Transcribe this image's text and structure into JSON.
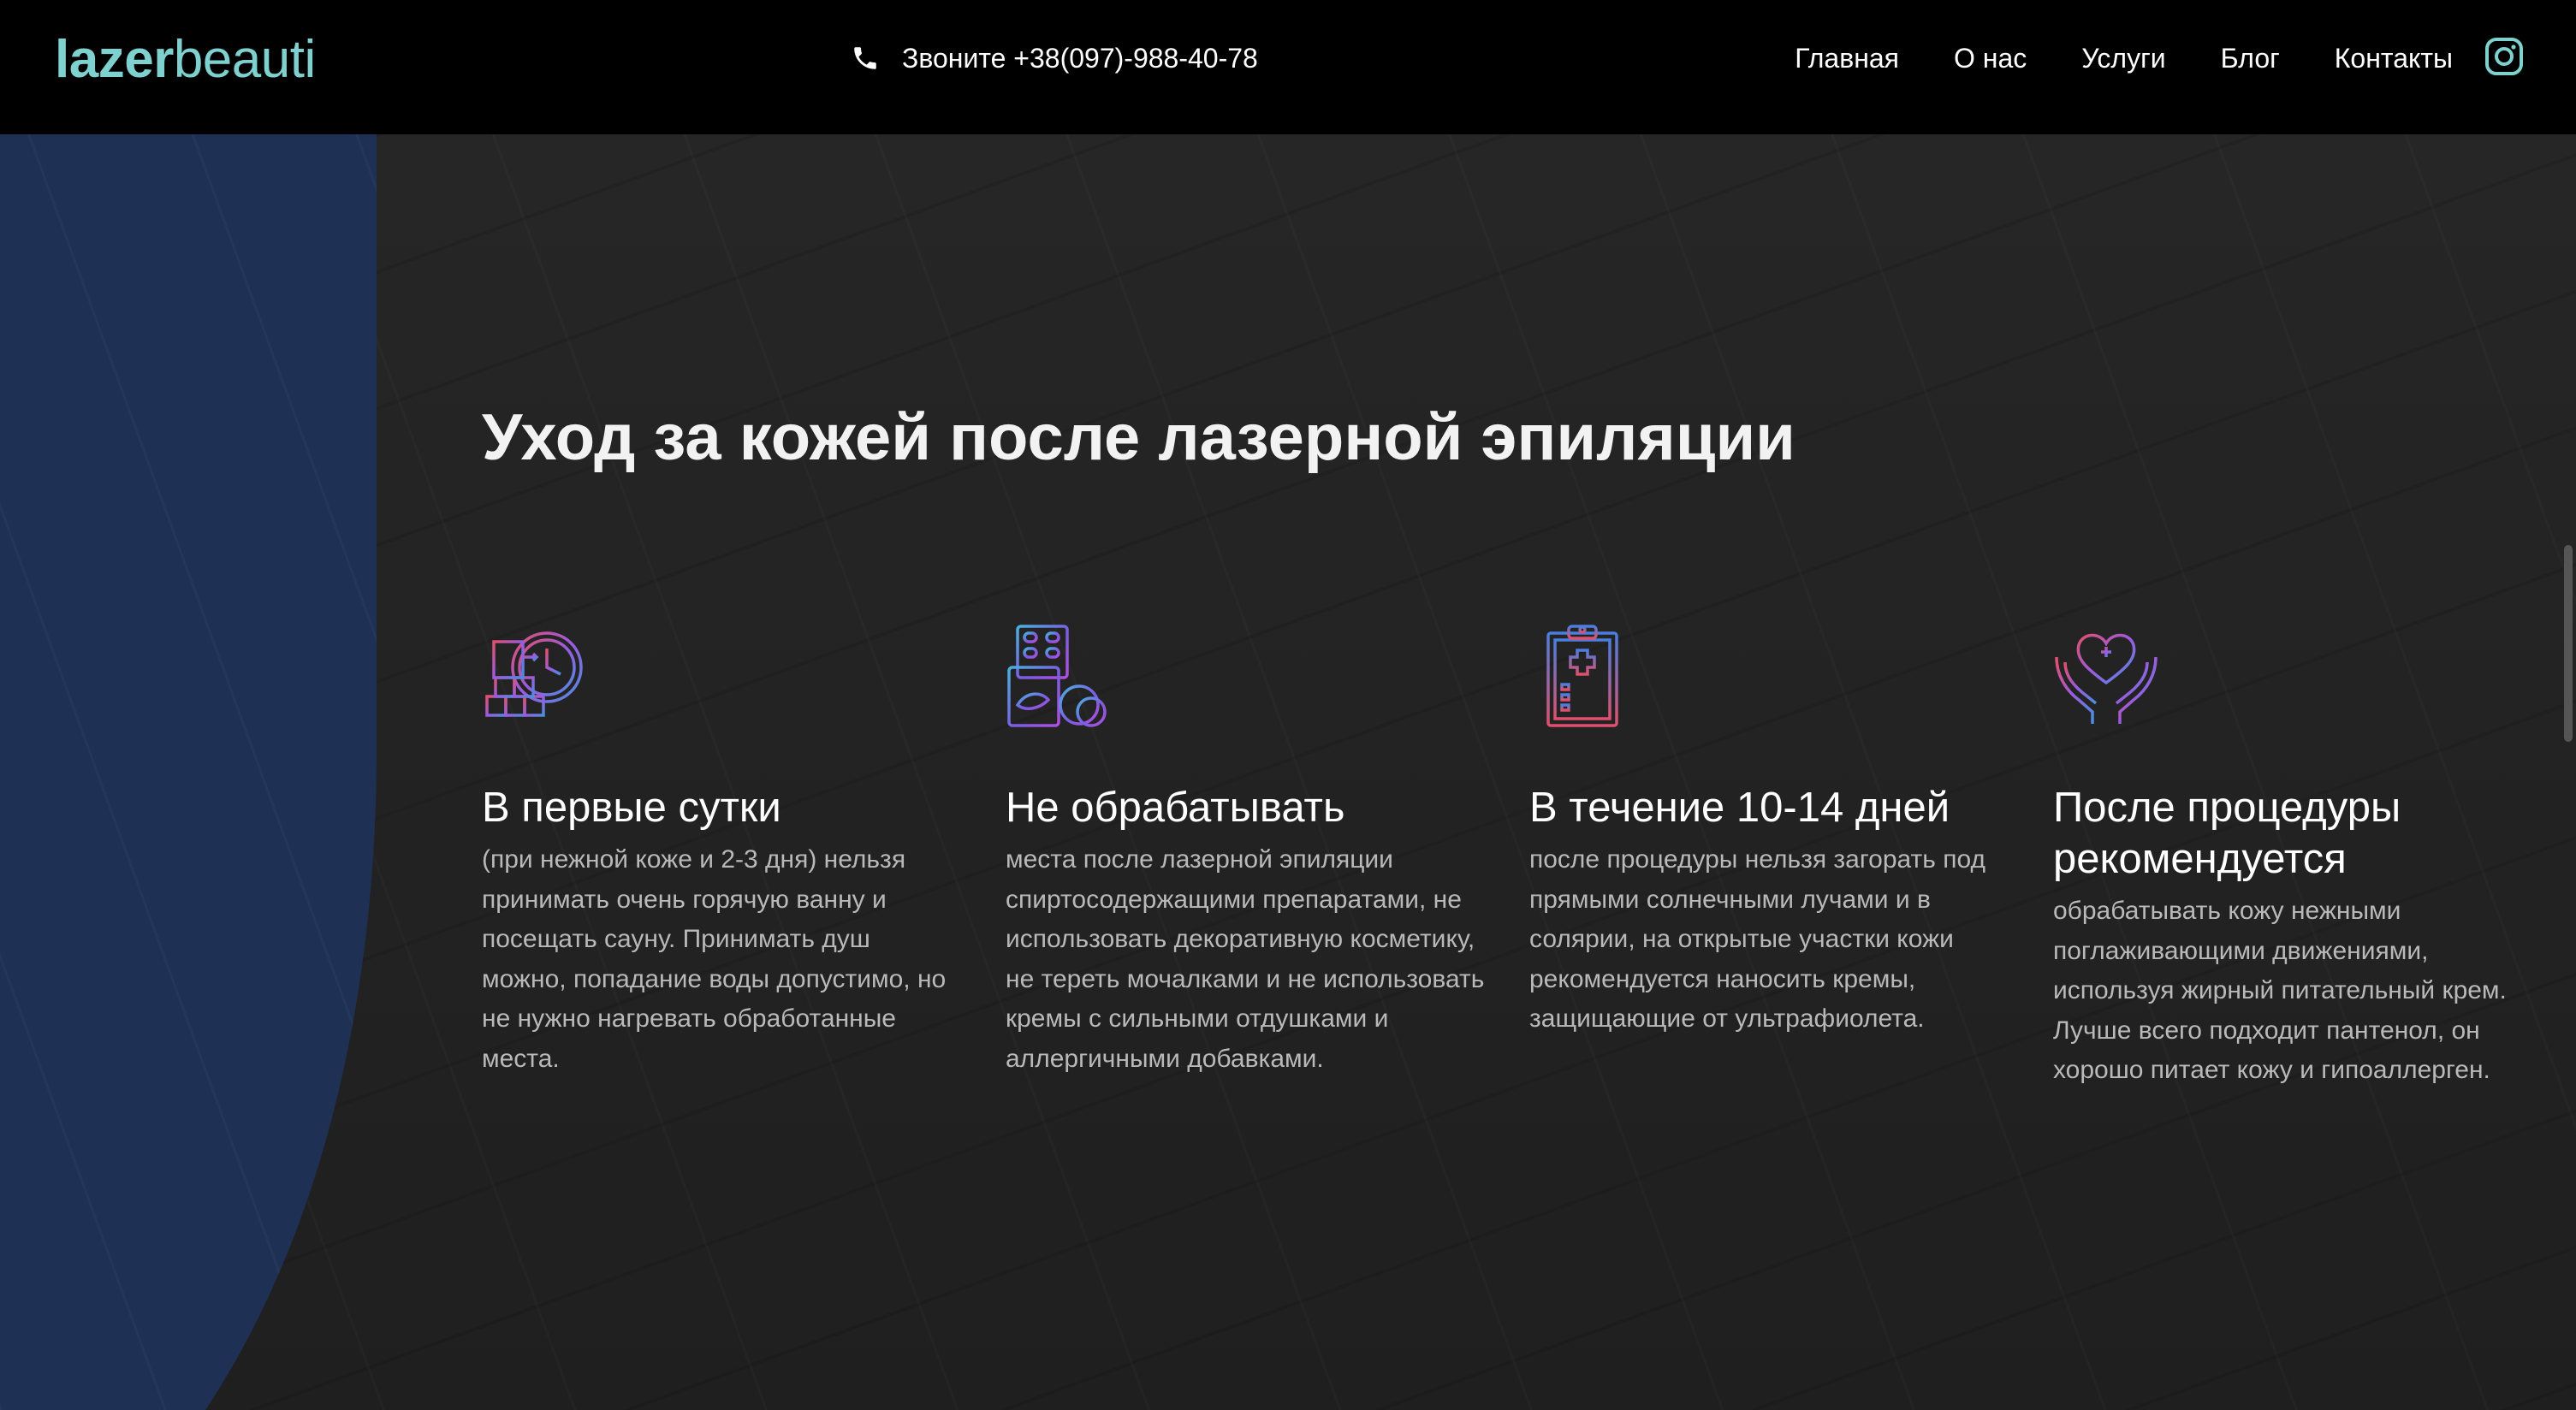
{
  "header": {
    "logo_bold": "lazer",
    "logo_light": "beauti",
    "phone_text": "Звоните +38(097)-988-40-78",
    "nav": [
      "Главная",
      "О нас",
      "Услуги",
      "Блог",
      "Контакты"
    ]
  },
  "section": {
    "title": "Уход за кожей после лазерной эпиляции",
    "cards": [
      {
        "icon": "time-blocks-icon",
        "title": "В первые сутки",
        "text": "(при нежной коже и 2-3 дня) нельзя принимать очень горячую ванну и посещать сауну. Принимать душ можно, попадание воды допустимо, но не нужно нагревать обработанные места."
      },
      {
        "icon": "pills-icon",
        "title": "Не обрабатывать",
        "text": "места после лазерной эпиляции спиртосодержащими препаратами, не использовать декоративную косметику, не тереть мочалками и не использовать кремы с сильными отдушками и аллергичными добавками."
      },
      {
        "icon": "medical-clipboard-icon",
        "title": "В течение 10-14 дней",
        "text": "после процедуры нельзя загорать под прямыми солнечными лучами и в солярии, на открытые участки кожи рекомендуется наносить кремы, защищающие от ультрафиолета."
      },
      {
        "icon": "heart-hands-icon",
        "title": "После процедуры рекомендуется",
        "text": "обрабатывать кожу нежными поглаживающими движениями, используя жирный питательный крем. Лучше всего подходит пантенол, он хорошо питает кожу и гипоаллерген."
      }
    ]
  },
  "colors": {
    "logo": "#7fd1cf",
    "header_bg": "#000000",
    "page_bg": "#232323",
    "blue_panel": "#1f3055",
    "icon_gradient": [
      "#e0506e",
      "#8a55e0",
      "#4a8ee0"
    ]
  }
}
